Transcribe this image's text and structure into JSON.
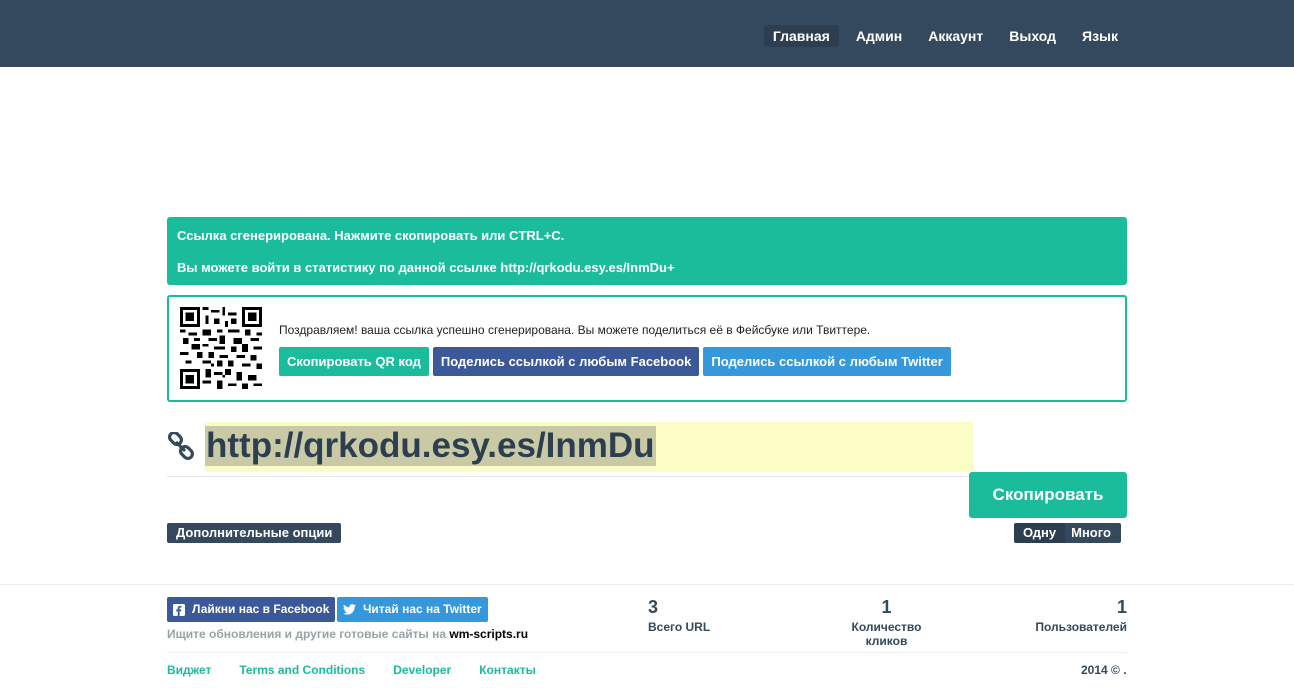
{
  "nav": {
    "items": [
      {
        "label": "Главная",
        "active": true
      },
      {
        "label": "Админ"
      },
      {
        "label": "Аккаунт"
      },
      {
        "label": "Выход"
      },
      {
        "label": "Язык"
      }
    ]
  },
  "alert": {
    "line1": "Ссылка сгенерирована. Нажмите скопировать или CTRL+C.",
    "line2": "Вы можете войти в статистику по данной ссылке http://qrkodu.esy.es/InmDu+"
  },
  "share": {
    "text": "Поздравляем! ваша ссылка успешно сгенерирована. Вы можете поделиться её в Фейсбуке или Твиттере.",
    "copy_qr_label": "Скопировать QR код",
    "facebook_label": "Поделись ссылкой с любым Facebook",
    "twitter_label": "Поделись ссылкой с любым Twitter"
  },
  "short_url": "http://qrkodu.esy.es/InmDu",
  "copy_label": "Скопировать",
  "extra_options_label": "Дополнительные опции",
  "mode_toggle": {
    "one": "Одну",
    "many": "Много"
  },
  "footer": {
    "like_facebook": "Лайкни нас в Facebook",
    "follow_twitter": "Читай нас на Twitter",
    "updates_text": "Ищите обновления и другие готовые сайты на",
    "updates_link": "wm-scripts.ru",
    "stats": [
      {
        "value": "3",
        "label": "Всего URL"
      },
      {
        "value": "1",
        "label": "Количество кликов"
      },
      {
        "value": "1",
        "label": "Пользователей"
      }
    ],
    "links": [
      "Виджет",
      "Terms and Conditions",
      "Developer",
      "Контакты"
    ],
    "copyright": "2014 © ."
  },
  "colors": {
    "navbar": "#34495e",
    "accent": "#1abc9c",
    "facebook": "#3b5998",
    "twitter": "#3498db",
    "url_highlight": "#fbfcc6"
  }
}
